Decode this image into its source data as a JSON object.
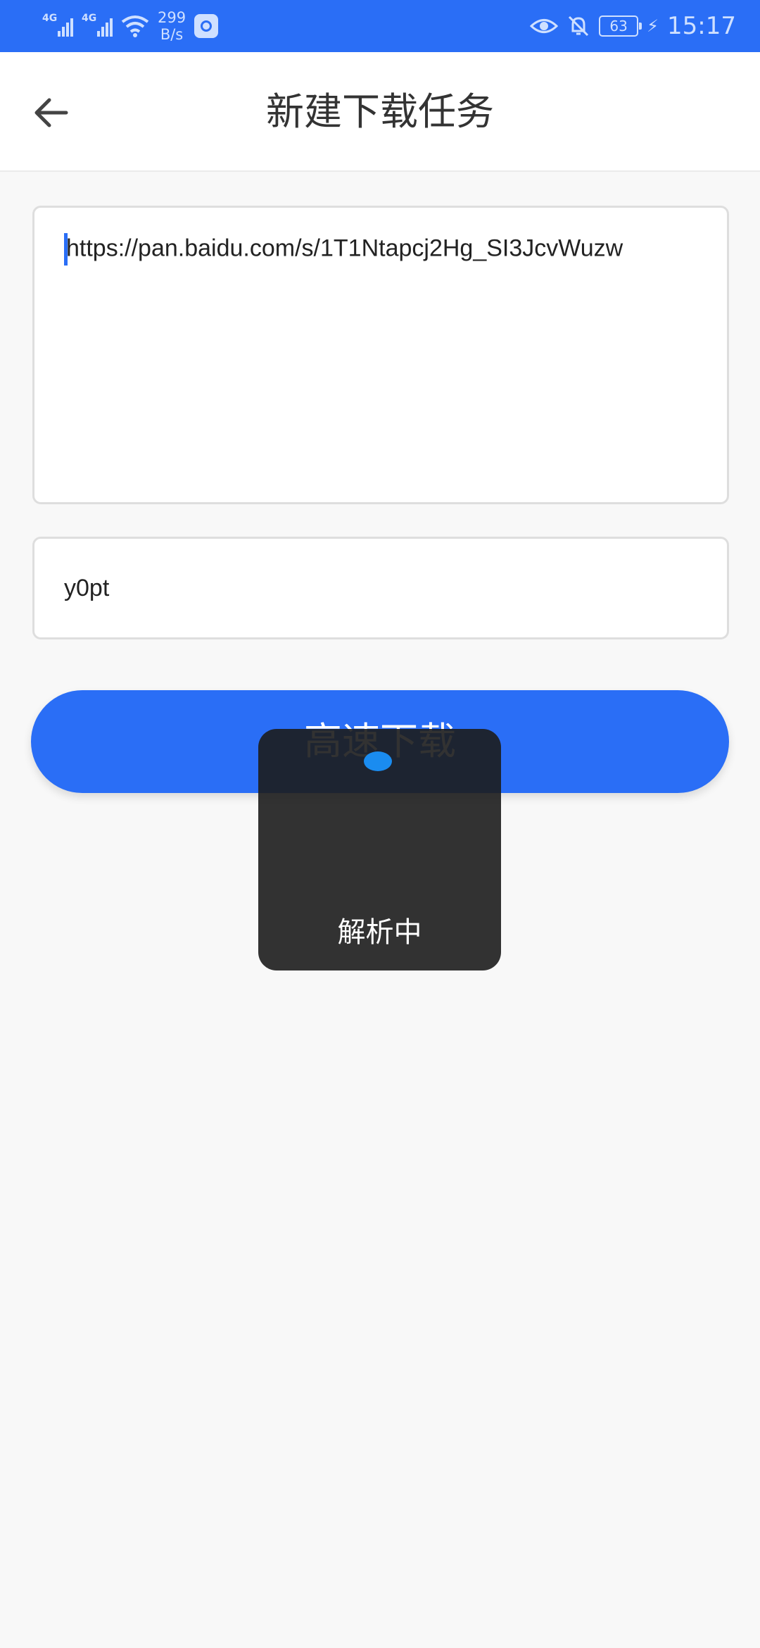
{
  "status_bar": {
    "network_1": "4G",
    "network_2": "4G",
    "speed_value": "299",
    "speed_unit": "B/s",
    "battery": "63",
    "time": "15:17",
    "icons": [
      "signal-icon",
      "signal-icon",
      "wifi-icon",
      "app-shield-icon",
      "eye-icon",
      "bell-off-icon",
      "battery-icon",
      "charging-icon"
    ]
  },
  "app_bar": {
    "title": "新建下载任务",
    "back_icon": "arrow-left-icon"
  },
  "form": {
    "url_value": "https://pan.baidu.com/s/1T1Ntapcj2Hg_SI3JcvWuzw",
    "code_value": "y0pt"
  },
  "button": {
    "label": "高速下载"
  },
  "loading": {
    "text": "解析中"
  },
  "colors": {
    "primary": "#2a6ef6",
    "background": "#f8f8f8",
    "toast": "#1c1c1c"
  }
}
